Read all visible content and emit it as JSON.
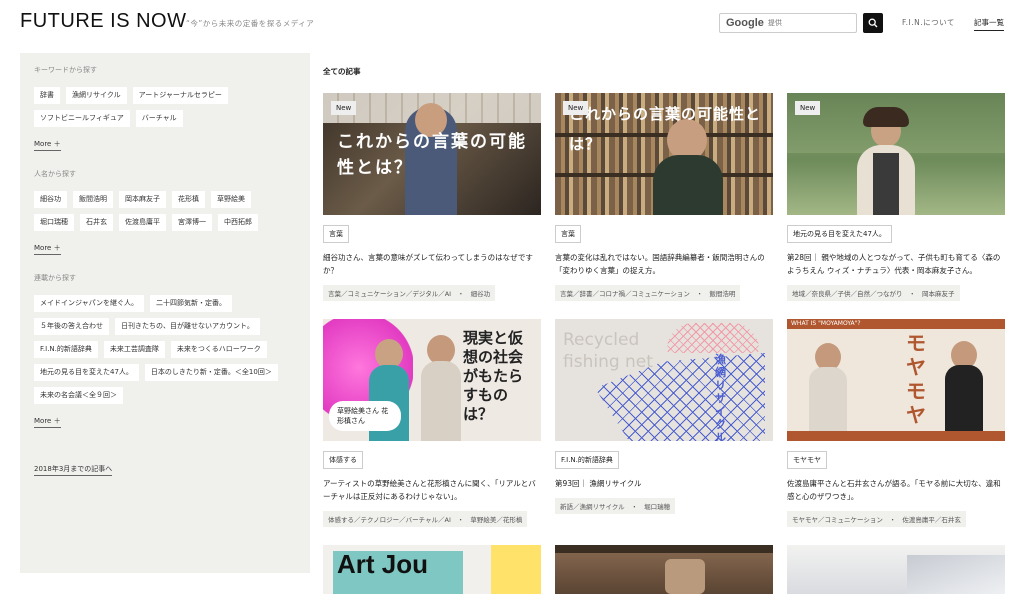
{
  "header": {
    "logo": "FUTURE IS NOW",
    "tagline": "“今”から未来の定番を探るメディア",
    "search_brand": "Google",
    "search_placeholder": "提供",
    "nav_about": "F.I.N.について",
    "nav_list": "記事一覧"
  },
  "sidebar": {
    "keyword_head": "キーワードから探す",
    "keywords": [
      "辞書",
      "漁網リサイクル",
      "アートジャーナルセラピー",
      "ソフトビニールフィギュア",
      "バーチャル"
    ],
    "people_head": "人名から探す",
    "people": [
      "細谷功",
      "飯間浩明",
      "岡本麻友子",
      "花形槙",
      "草野絵美",
      "堀口瑞穂",
      "石井玄",
      "佐渡島庸平",
      "宮澤博一",
      "中西拓郎"
    ],
    "series_head": "連載から探す",
    "series": [
      "メイドインジャパンを継ぐ人。",
      "二十四節気新・定番。",
      "５年後の答え合わせ",
      "日刊きたちの、目が離せないアカウント。",
      "F.I.N.的新語辞典",
      "未来工芸調査隊",
      "未来をつくるハローワーク",
      "地元の見る目を変えた47人。",
      "日本のしきたり新・定番。＜全10回＞",
      "未来の名会議＜全９回＞"
    ],
    "more_label": "More ＋",
    "archive_link": "2018年3月までの記事へ"
  },
  "main": {
    "section_title": "全ての記事",
    "new_badge": "New",
    "cards": [
      {
        "thumb_text": "これからの言葉の可能性とは？",
        "category": "言葉",
        "title": "細谷功さん、言葉の意味がズレて伝わってしまうのはなぜですか？",
        "meta": "言葉／コミュニケーション／デジタル／AI　・　細谷功",
        "new": "true"
      },
      {
        "thumb_text": "これからの言葉の可能性とは？",
        "category": "言葉",
        "title": "言葉の変化は乱れではない。国語辞典編纂者・飯間浩明さんの「変わりゆく言葉」の捉え方。",
        "meta": "言葉／辞書／コロナ禍／コミュニケーション　・　飯間浩明",
        "new": "true"
      },
      {
        "thumb_text": "",
        "category": "地元の見る目を変えた47人。",
        "title": "第28回｜ 親や地域の人とつながって、子供も町も育てる〈森のようちえん ウィズ・ナチュラ〉代表・岡本麻友子さん。",
        "meta": "地域／奈良県／子供／自然／つながり　・　岡本麻友子",
        "new": "true"
      },
      {
        "thumb_text": "現実と仮想の社会がもたらすものは？",
        "thumb_caption": "草野絵美さん 花形槙さん",
        "category": "体感する",
        "title": "アーティストの草野絵美さんと花形槙さんに聞く、「リアルとバーチャルは正反対にあるわけじゃない」。",
        "meta": "体感する／テクノロジー／バーチャル／AI　・　草野絵美／花形槙",
        "new": "false"
      },
      {
        "thumb_text": "Recycled fishing net",
        "thumb_caption": "漁網リサイクル",
        "category": "F.I.N.的新語辞典",
        "title": "第93回｜ 漁網リサイクル",
        "meta": "新語／漁網リサイクル　・　堀口瑞穂",
        "new": "false"
      },
      {
        "thumb_text": "モヤモヤって何？",
        "thumb_caption": "WHAT IS \"MOYAMOYA\"?",
        "category": "モヤモヤ",
        "title": "佐渡島庸平さんと石井玄さんが語る。「モヤる前に大切な、違和感と心のザワつき」。",
        "meta": "モヤモヤ／コミュニケーション　・　佐渡島庸平／石井玄",
        "new": "false"
      },
      {
        "thumb_text": "Art Jou",
        "category": "",
        "title": "",
        "meta": "",
        "new": "false"
      }
    ]
  }
}
